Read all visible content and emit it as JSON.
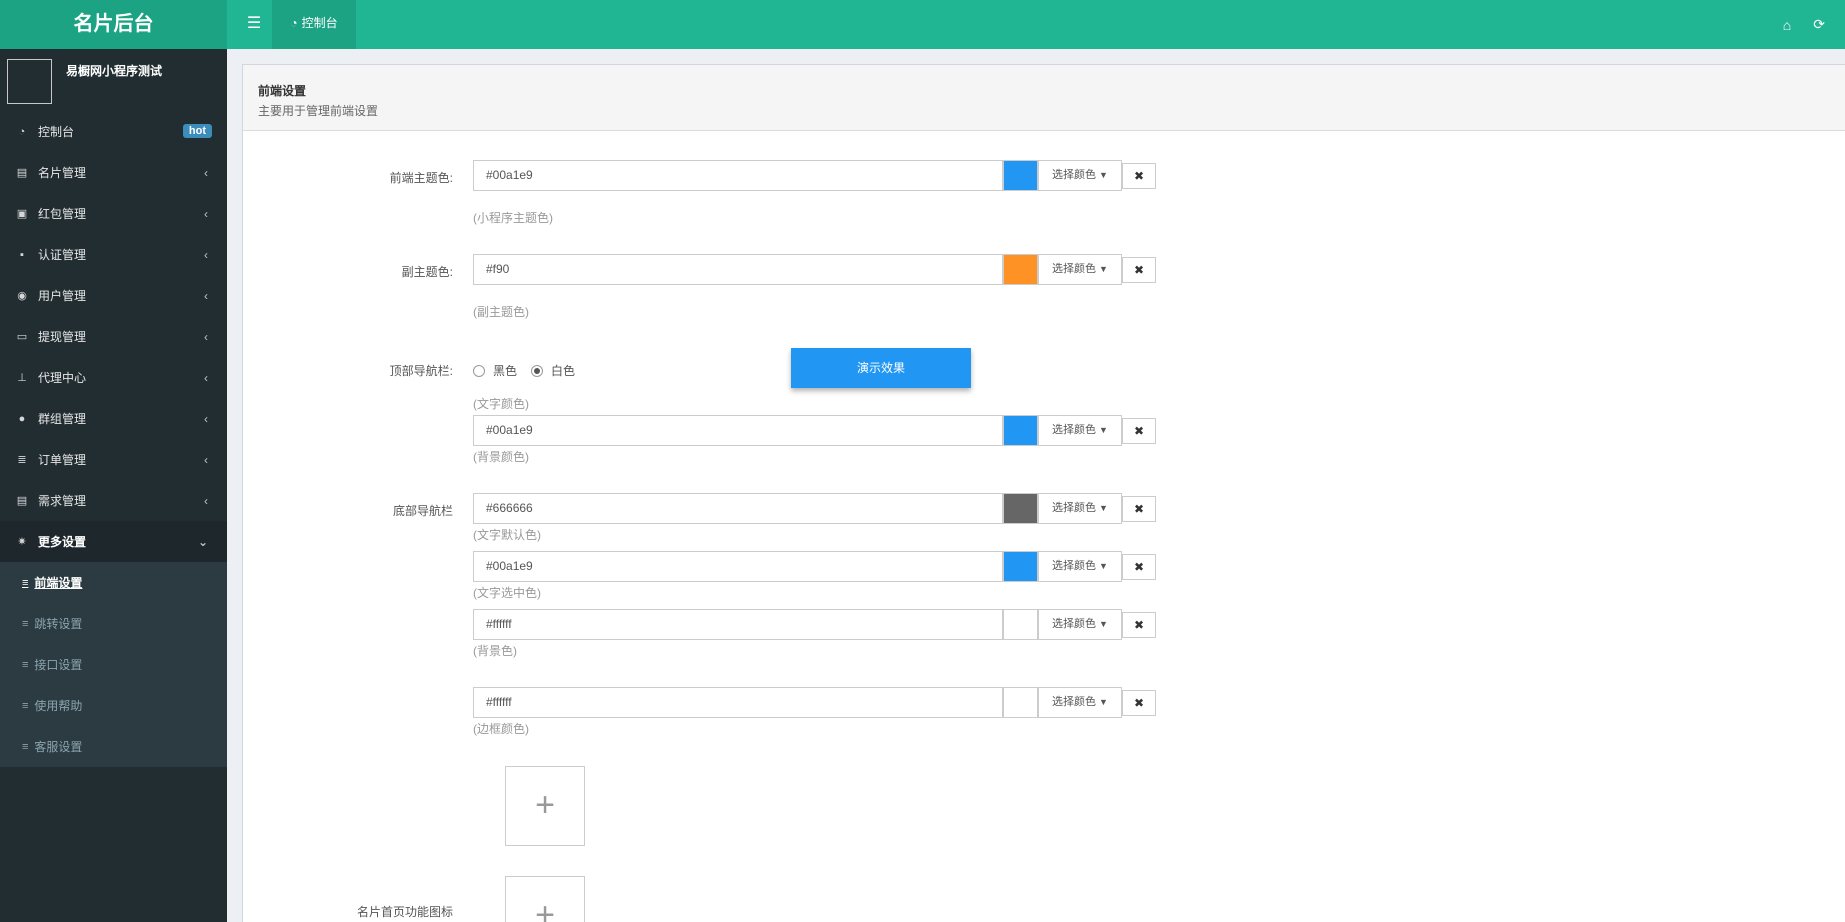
{
  "topbar": {
    "logo": "名片后台",
    "tab_label": "控制台"
  },
  "sidebar": {
    "user_name": "易橱网小程序测试",
    "hot_badge": "hot",
    "items": [
      {
        "label": "控制台",
        "icon": "dashboard-icon"
      },
      {
        "label": "名片管理",
        "icon": "id-card-icon"
      },
      {
        "label": "红包管理",
        "icon": "archive-icon"
      },
      {
        "label": "认证管理",
        "icon": "user-badge-icon"
      },
      {
        "label": "用户管理",
        "icon": "user-circle-icon"
      },
      {
        "label": "提现管理",
        "icon": "money-icon"
      },
      {
        "label": "代理中心",
        "icon": "sitemap-icon"
      },
      {
        "label": "群组管理",
        "icon": "users-icon"
      },
      {
        "label": "订单管理",
        "icon": "list-icon"
      },
      {
        "label": "需求管理",
        "icon": "list-alt-icon"
      },
      {
        "label": "更多设置",
        "icon": "gear-icon"
      }
    ],
    "submenu": [
      {
        "label": "前端设置"
      },
      {
        "label": "跳转设置"
      },
      {
        "label": "接口设置"
      },
      {
        "label": "使用帮助"
      },
      {
        "label": "客服设置"
      }
    ]
  },
  "box": {
    "title": "前端设置",
    "subtitle": "主要用于管理前端设置"
  },
  "form": {
    "pick_label": "选择颜色",
    "theme_label": "前端主题色:",
    "theme_value": "#00a1e9",
    "theme_help": "(小程序主题色)",
    "sub_label": "副主题色:",
    "sub_value": "#f90",
    "sub_help": "(副主题色)",
    "topnav_label": "顶部导航栏:",
    "radio_black": "黑色",
    "radio_white": "白色",
    "topnav_text_help": "(文字颜色)",
    "topnav_bg_value": "#00a1e9",
    "topnav_bg_help": "(背景颜色)",
    "demo_button": "演示效果",
    "bottomnav_label": "底部导航栏",
    "bottom_text_value": "#666666",
    "bottom_text_help": "(文字默认色)",
    "bottom_sel_value": "#00a1e9",
    "bottom_sel_help": "(文字选中色)",
    "bottom_bg_value": "#ffffff",
    "bottom_bg_help": "(背景色)",
    "bottom_border_value": "#ffffff",
    "bottom_border_help": "(边框颜色)",
    "icon_label": "名片首页功能图标"
  },
  "colors": {
    "brand": "#20b593",
    "theme": "#2196f3",
    "sub": "#ff9224",
    "gray": "#666666",
    "white": "#ffffff"
  }
}
